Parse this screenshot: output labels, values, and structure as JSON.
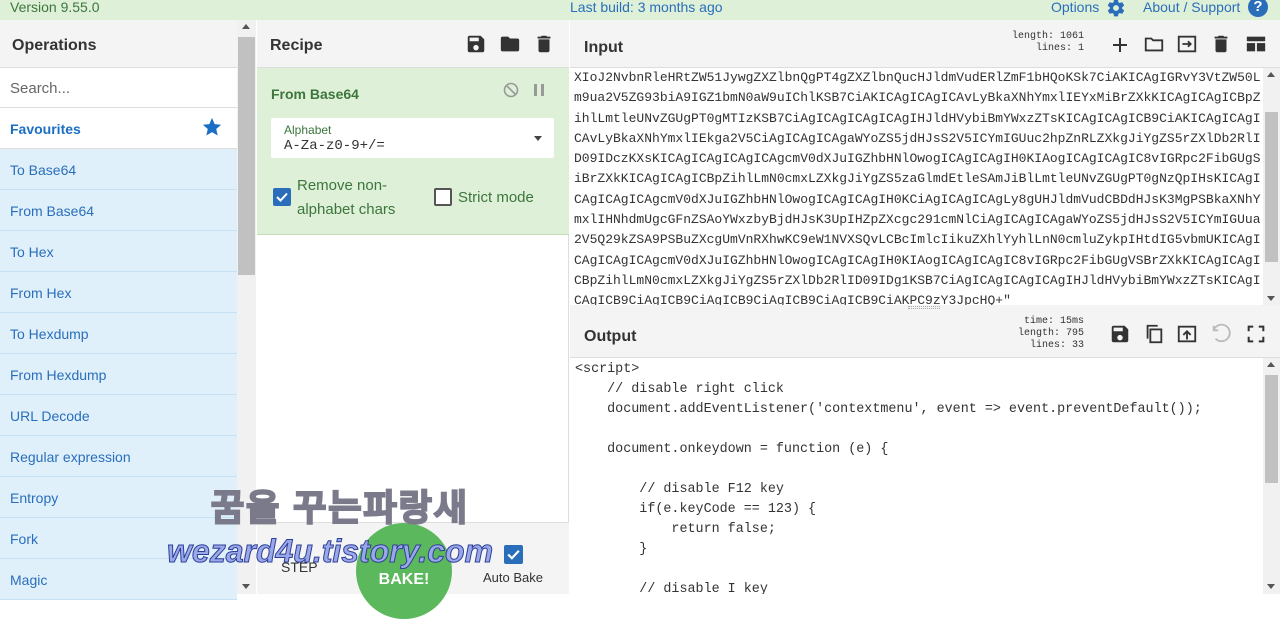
{
  "banner": {
    "version": "Version 9.55.0",
    "last_build": "Last build: 3 months ago",
    "options": "Options",
    "about": "About / Support"
  },
  "operations": {
    "title": "Operations",
    "search_placeholder": "Search...",
    "favourites": "Favourites",
    "items": [
      "To Base64",
      "From Base64",
      "To Hex",
      "From Hex",
      "To Hexdump",
      "From Hexdump",
      "URL Decode",
      "Regular expression",
      "Entropy",
      "Fork",
      "Magic"
    ]
  },
  "recipe": {
    "title": "Recipe",
    "operation": {
      "name": "From Base64",
      "alphabet_label": "Alphabet",
      "alphabet_value": "A-Za-z0-9+/=",
      "remove_non_alpha_label": "Remove non-alphabet chars",
      "remove_non_alpha_checked": true,
      "strict_mode_label": "Strict mode",
      "strict_mode_checked": false
    },
    "step_label": "STEP",
    "bake_label": "BAKE!",
    "auto_bake_label": "Auto Bake",
    "auto_bake_checked": true
  },
  "watermark": {
    "line1": "꿈을 꾸는파랑새",
    "line2": "wezard4u.tistory.com"
  },
  "input": {
    "title": "Input",
    "length_label": "length:",
    "length": "1061",
    "lines_label": "lines:",
    "lines": "1",
    "text": "XIoJ2NvbnRleHRtZW51JywgZXZlbnQgPT4gZXZlbnQucHJldmVudERlZmF1bHQoKSk7CiAKICAgIGRvY3VtZW50Lm9ua2V5ZG93biA9IGZ1bmN0aW9uIChlKSB7CiAKICAgICAgICAvLyBkaXNhYmxlIEYxMiBrZXkKICAgICAgICBpZihlLmtleUNvZGUgPT0gMTIzKSB7CiAgICAgICAgICAgIHJldHVybiBmYWxzZTsKICAgICAgICB9CiAKICAgICAgICAvLyBkaXNhYmxlIEkga2V5CiAgICAgICAgaWYoZS5jdHJsS2V5ICYmIGUuc2hpZnRLZXkgJiYgZS5rZXlDb2RlID09IDczKXsKICAgICAgICAgICAgcmV0dXJuIGZhbHNlOwogICAgICAgIH0KIAogICAgICAgIC8vIGRpc2FibGUgSiBrZXkKICAgICAgICBpZihlLmN0cmxLZXkgJiYgZS5zaGlmdEtleSAmJiBlLmtleUNvZGUgPT0gNzQpIHsKICAgICAgICAgICAgcmV0dXJuIGZhbHNlOwogICAgICAgIH0KCiAgICAgICAgLy8gUHJldmVudCBDdHJsK3MgPSBkaXNhYmxlIHNhdmUgcGFnZSAoYWxzbyBjdHJsK3UpIHZpZXcgc291cmNlCiAgICAgICAgaWYoZS5jdHJsS2V5ICYmIGUua2V5Q29kZSA9PSBuZXcgUmVnRXhwKC9eW1NVXSQvLCBcImlcIikuZXhlYyhlLnN0cmluZykpIHtdIG5vbmUKICAgICAgICAgICAgcmV0dXJuIGZhbHNlOwogICAgICAgIH0KIAogICAgICAgIC8vIGRpc2FibGUgVSBrZXkKICAgICAgICBpZihlLmN0cmxLZXkgJiYgZS5rZXlDb2RlID09IDg1KSB7CiAgICAgICAgICAgIHJldHVybiBmYWxzZTsKICAgICAgICB9CiAgICB9CiAgICB9CiAgICB9CiAgICB9CiAKPC9zY3JpcHQ+\""
  },
  "output": {
    "title": "Output",
    "time_label": "time:",
    "time": "15ms",
    "length_label": "length:",
    "length": "795",
    "lines_label": "lines:",
    "lines": "33",
    "text": "<script>\n    // disable right click\n    document.addEventListener('contextmenu', event => event.preventDefault());\n\n    document.onkeydown = function (e) {\n\n        // disable F12 key\n        if(e.keyCode == 123) {\n            return false;\n        }\n\n        // disable I key"
  },
  "colors": {
    "accent": "#2a6ebb",
    "banner_bg": "#dff0d8",
    "favourite_items_bg": "#dff0fb",
    "bake_green": "#5cb85c"
  }
}
